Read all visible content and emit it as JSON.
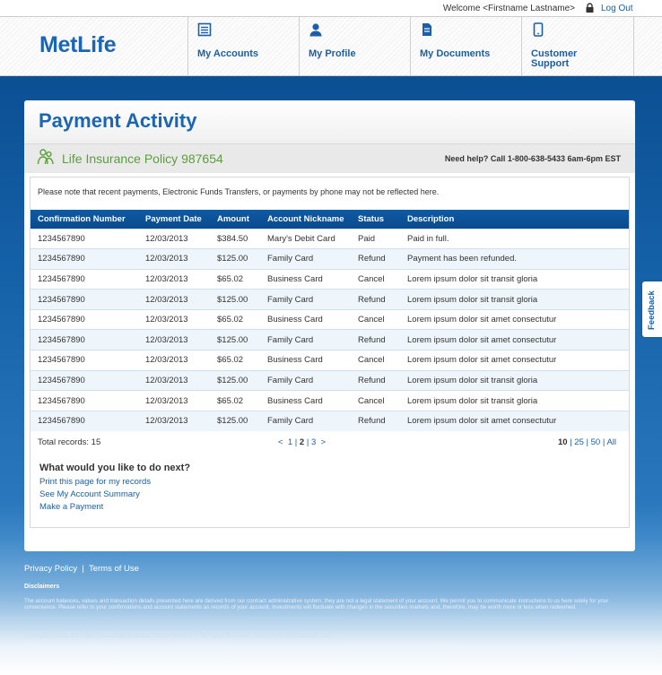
{
  "topbar": {
    "welcome": "Welcome <Firstname Lastname>",
    "logout": "Log Out"
  },
  "header": {
    "logo": "MetLife",
    "nav": [
      {
        "label": "My Accounts",
        "icon": "accounts-icon"
      },
      {
        "label": "My Profile",
        "icon": "profile-icon"
      },
      {
        "label": "My Documents",
        "icon": "documents-icon"
      },
      {
        "label": "Customer Support",
        "icon": "phone-icon"
      }
    ]
  },
  "panel": {
    "title": "Payment Activity",
    "policy": "Life Insurance Policy 987654",
    "help": "Need help? Call 1-800-638-5433 6am-6pm EST",
    "note": "Please note that recent payments, Electronic Funds Transfers, or payments by phone may not be reflected here."
  },
  "table": {
    "columns": [
      "Confirmation Number",
      "Payment Date",
      "Amount",
      "Account Nickname",
      "Status",
      "Description"
    ],
    "rows": [
      [
        "1234567890",
        "12/03/2013",
        "$384.50",
        "Mary's Debit Card",
        "Paid",
        "Paid in full."
      ],
      [
        "1234567890",
        "12/03/2013",
        "$125.00",
        "Family Card",
        "Refund",
        "Payment has been refunded."
      ],
      [
        "1234567890",
        "12/03/2013",
        "$65.02",
        "Business Card",
        "Cancel",
        "Lorem ipsum dolor sit transit gloria"
      ],
      [
        "1234567890",
        "12/03/2013",
        "$125.00",
        "Family Card",
        "Refund",
        "Lorem ipsum dolor sit transit gloria"
      ],
      [
        "1234567890",
        "12/03/2013",
        "$65.02",
        "Business Card",
        "Cancel",
        "Lorem ipsum dolor sit amet consectutur"
      ],
      [
        "1234567890",
        "12/03/2013",
        "$125.00",
        "Family Card",
        "Refund",
        "Lorem ipsum dolor sit amet consectutur"
      ],
      [
        "1234567890",
        "12/03/2013",
        "$65.02",
        "Business Card",
        "Cancel",
        "Lorem ipsum dolor sit amet consectutur"
      ],
      [
        "1234567890",
        "12/03/2013",
        "$125.00",
        "Family Card",
        "Refund",
        "Lorem ipsum dolor sit transit gloria"
      ],
      [
        "1234567890",
        "12/03/2013",
        "$65.02",
        "Business Card",
        "Cancel",
        "Lorem ipsum dolor sit transit gloria"
      ],
      [
        "1234567890",
        "12/03/2013",
        "$125.00",
        "Family Card",
        "Refund",
        "Lorem ipsum dolor sit amet consectutur"
      ]
    ]
  },
  "pagination": {
    "total": "Total records: 15",
    "prev": "<",
    "pages": [
      "1",
      "2",
      "3"
    ],
    "current": "2",
    "next": ">",
    "per_page": [
      "10",
      "25",
      "50",
      "All"
    ],
    "per_page_current": "10"
  },
  "next_steps": {
    "title": "What would you like to do next?",
    "links": [
      "Print this page for my records",
      "See My Account Summary",
      "Make a Payment"
    ]
  },
  "feedback": "Feedback",
  "footer": {
    "privacy": "Privacy Policy",
    "terms": "Terms of Use",
    "separator": "|",
    "disclaimers_title": "Disclaimers",
    "disclaimer": "The account balances, values and transaction details presented here are derived from our contract administrative system; they are not a legal statement of your account. We permit you to communicate instructions to us here solely for your convenience. Please refer to your confirmations and account statements as records of your account. Investments will fluctuate with changes in the securities markets and, therefore, may be worth more or less when redeemed.",
    "copyright": "Copyright © 2003–2012 Metropolitan Life Insurance Company NY, NY - All Rights Reserved - E00108VIN MLIC-LD/LCh 2393"
  },
  "colors": {
    "brand": "#1a66b5",
    "header_row": "#0e5aa5",
    "policy_green": "#5b9e3c",
    "link": "#1a5fa8"
  }
}
